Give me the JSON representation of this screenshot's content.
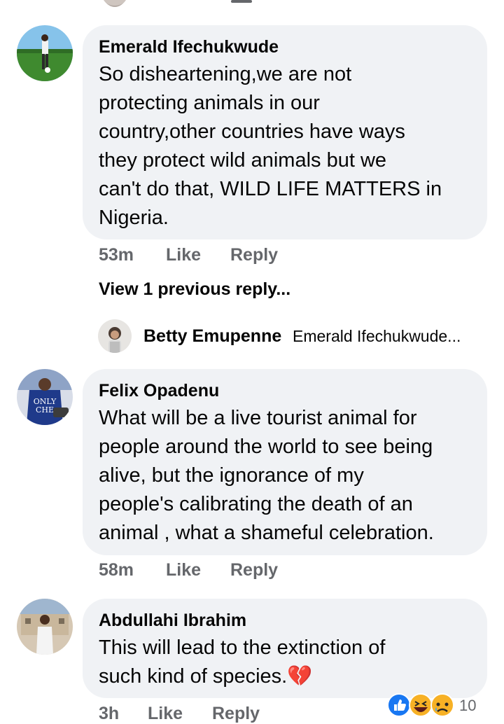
{
  "comments": [
    {
      "author": "Emerald Ifechukwude",
      "lines": [
        "So disheartening,we are not",
        "protecting animals in our",
        "country,other countries have ways",
        "they protect wild animals but we",
        "can't do that, WILD LIFE MATTERS in",
        "Nigeria."
      ],
      "time": "53m",
      "like_label": "Like",
      "reply_label": "Reply",
      "view_previous": "View 1 previous reply...",
      "reply_preview": {
        "author": "Betty Emupenne",
        "text": "Emerald Ifechukwude..."
      }
    },
    {
      "author": "Felix Opadenu",
      "lines": [
        "What will be a live tourist animal for",
        "people around the world to see being",
        "alive, but the ignorance of my",
        "people's calibrating the death of an",
        "animal , what a shameful celebration."
      ],
      "time": "58m",
      "like_label": "Like",
      "reply_label": "Reply"
    },
    {
      "author": "Abdullahi Ibrahim",
      "lines": [
        "This will lead to the extinction of",
        "such kind of species."
      ],
      "emoji": "💔",
      "time": "3h",
      "like_label": "Like",
      "reply_label": "Reply",
      "reactions": {
        "icons": [
          "like-reaction-icon",
          "haha-reaction-icon",
          "sad-reaction-icon"
        ],
        "count": "10"
      }
    }
  ],
  "colors": {
    "bubble": "#f0f2f5",
    "meta_text": "#65676b",
    "like_blue": "#1877f2",
    "emoji_yellow": "#f7b125"
  }
}
